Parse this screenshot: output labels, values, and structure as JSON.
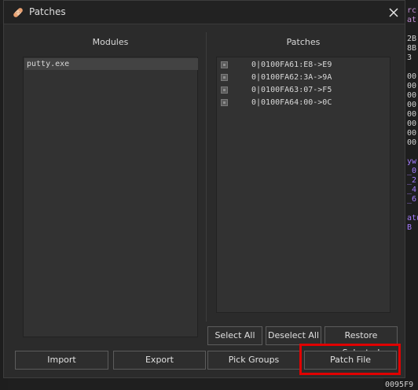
{
  "dialog": {
    "title": "Patches"
  },
  "modules": {
    "label": "Modules",
    "items": [
      "putty.exe"
    ]
  },
  "patches": {
    "label": "Patches",
    "items": [
      "0|0100FA61:E8->E9",
      "0|0100FA62:3A->9A",
      "0|0100FA63:07->F5",
      "0|0100FA64:00->0C"
    ]
  },
  "buttons": {
    "select_all": "Select All",
    "deselect_all": "Deselect All",
    "restore_selected": "Restore Selected",
    "import": "Import",
    "export": "Export",
    "pick_groups": "Pick Groups",
    "patch_file": "Patch File"
  },
  "background": {
    "right_lines": [
      "rc",
      "at",
      "",
      "2B",
      "8B",
      "3",
      "",
      "00",
      "00",
      "00",
      "00",
      "00",
      "00",
      "00",
      "00",
      "",
      "yw",
      "_0",
      "_2",
      "_4",
      "_6",
      "",
      "atu",
      "B"
    ],
    "bottom_lines": [
      "F9",
      "F9",
      "0095F9"
    ]
  },
  "colors": {
    "highlight": "#e00000",
    "dialog_bg": "#2b2b2b",
    "list_bg": "#323232",
    "selected_row": "#434343"
  }
}
